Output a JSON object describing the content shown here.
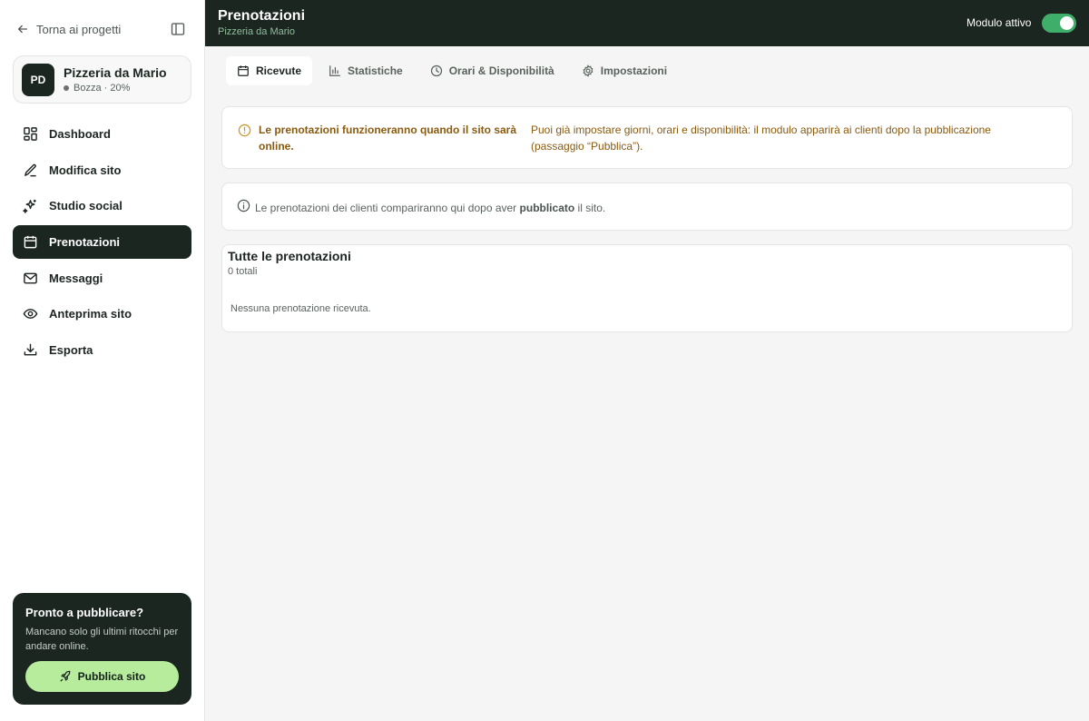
{
  "sidebar": {
    "back_label": "Torna ai progetti",
    "project": {
      "initials": "PD",
      "name": "Pizzeria da Mario",
      "status": "Bozza · 20%"
    },
    "items": [
      {
        "label": "Dashboard",
        "icon": "dashboard-icon"
      },
      {
        "label": "Modifica sito",
        "icon": "pencil-icon"
      },
      {
        "label": "Studio social",
        "icon": "sparkles-icon"
      },
      {
        "label": "Prenotazioni",
        "icon": "calendar-icon",
        "active": true
      },
      {
        "label": "Messaggi",
        "icon": "mail-icon"
      },
      {
        "label": "Anteprima sito",
        "icon": "eye-icon"
      },
      {
        "label": "Esporta",
        "icon": "download-icon"
      }
    ],
    "publish": {
      "title": "Pronto a pubblicare?",
      "text": "Mancano solo gli ultimi ritocchi per andare online.",
      "button": "Pubblica sito"
    }
  },
  "header": {
    "title": "Prenotazioni",
    "subtitle": "Pizzeria da Mario",
    "module_label": "Modulo attivo",
    "module_active": true
  },
  "tabs": [
    {
      "label": "Ricevute",
      "icon": "calendar-icon",
      "active": true
    },
    {
      "label": "Statistiche",
      "icon": "bar-chart-icon"
    },
    {
      "label": "Orari & Disponibilità",
      "icon": "clock-icon"
    },
    {
      "label": "Impostazioni",
      "icon": "gear-icon"
    }
  ],
  "warning": {
    "title": "Le prenotazioni funzioneranno quando il sito sarà online.",
    "text": "Puoi già impostare giorni, orari e disponibilità: il modulo apparirà ai clienti dopo la pubblicazione (passaggio “Pubblica”)."
  },
  "info": {
    "before": "Le prenotazioni dei clienti compariranno qui dopo aver",
    "bold": "pubblicato",
    "after": "il sito."
  },
  "bookings": {
    "title": "Tutte le prenotazioni",
    "count": "0 totali",
    "empty": "Nessuna prenotazione ricevuta."
  },
  "colors": {
    "dark": "#1b2620",
    "accent_green": "#b6ec9c",
    "toggle_green": "#3fae6a",
    "warning_text": "#8a5a0f"
  }
}
